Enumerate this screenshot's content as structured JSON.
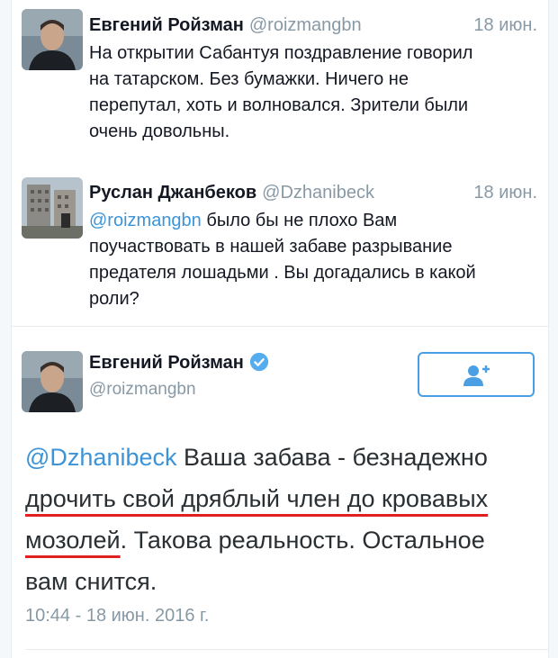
{
  "tweets": [
    {
      "name": "Евгений Ройзман",
      "handle": "@roizmangbn",
      "time": "18 июн.",
      "lines": [
        "На открытии Сабантуя поздравление говорил",
        "на татарском. Без бумажки. Ничего не",
        "перепутал, хоть и волновался. Зрители были",
        "очень довольны."
      ]
    },
    {
      "name": "Руслан Джанбеков",
      "handle": "@Dzhanibeck",
      "time": "18 июн.",
      "lines": [
        "@roizmangbn было бы не плохо Вам",
        "поучаствовать в нашей забаве разрывание",
        "предателя лошадьми . Вы догадались в какой",
        "роли?"
      ]
    }
  ],
  "main_tweet": {
    "name": "Евгений Ройзман",
    "handle": "@roizmangbn",
    "mention": "@Dzhanibeck",
    "text_line1_rest": " Ваша забава - безнадежно",
    "text_line2_underlined": "дрочить свой дряблый член до кровавых",
    "text_line3_underlined": "мозолей",
    "text_line3_rest": ". Такова реальность. Остальное",
    "text_line4": "вам снится.",
    "timestamp": "10:44 - 18 июн. 2016 г."
  },
  "icons": {
    "verified": "verified-badge-icon",
    "follow": "add-user-icon"
  },
  "colors": {
    "link": "#3b94d9",
    "muted": "#8899a6",
    "underline": "#e02020",
    "follow_border": "#4a9fe4"
  }
}
